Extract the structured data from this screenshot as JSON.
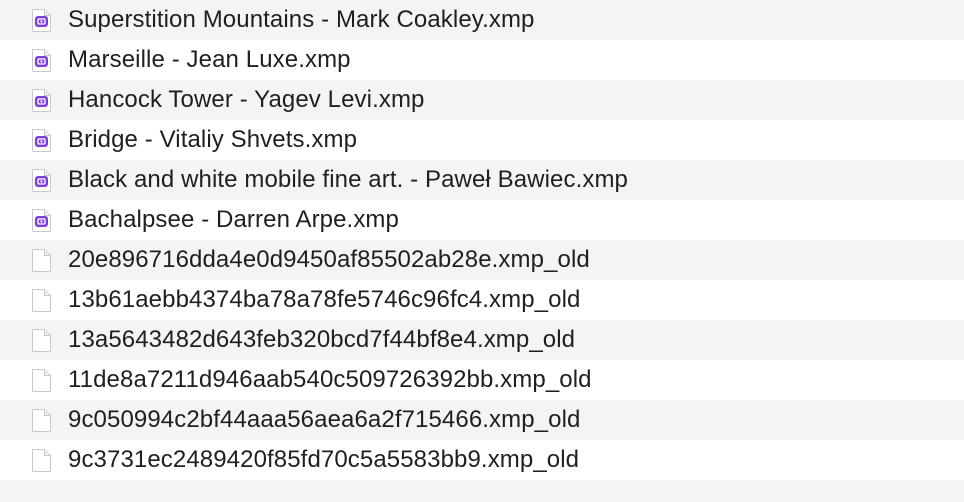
{
  "files": [
    {
      "name": "Superstition Mountains - Mark Coakley.xmp",
      "icon": "xmp-file-icon"
    },
    {
      "name": "Marseille - Jean Luxe.xmp",
      "icon": "xmp-file-icon"
    },
    {
      "name": "Hancock Tower - Yagev Levi.xmp",
      "icon": "xmp-file-icon"
    },
    {
      "name": "Bridge - Vitaliy Shvets.xmp",
      "icon": "xmp-file-icon"
    },
    {
      "name": "Black and white mobile fine art. - Paweł Bawiec.xmp",
      "icon": "xmp-file-icon"
    },
    {
      "name": "Bachalpsee - Darren Arpe.xmp",
      "icon": "xmp-file-icon"
    },
    {
      "name": "20e896716dda4e0d9450af85502ab28e.xmp_old",
      "icon": "blank-document-icon"
    },
    {
      "name": "13b61aebb4374ba78a78fe5746c96fc4.xmp_old",
      "icon": "blank-document-icon"
    },
    {
      "name": "13a5643482d643feb320bcd7f44bf8e4.xmp_old",
      "icon": "blank-document-icon"
    },
    {
      "name": "11de8a7211d946aab540c509726392bb.xmp_old",
      "icon": "blank-document-icon"
    },
    {
      "name": "9c050994c2bf44aaa56aea6a2f715466.xmp_old",
      "icon": "blank-document-icon"
    },
    {
      "name": "9c3731ec2489420f85fd70c5a5583bb9.xmp_old",
      "icon": "blank-document-icon"
    }
  ],
  "colors": {
    "row_alt": "#f4f4f4",
    "xmp_badge": "#7b3fe0",
    "text": "#1f1f1f"
  }
}
